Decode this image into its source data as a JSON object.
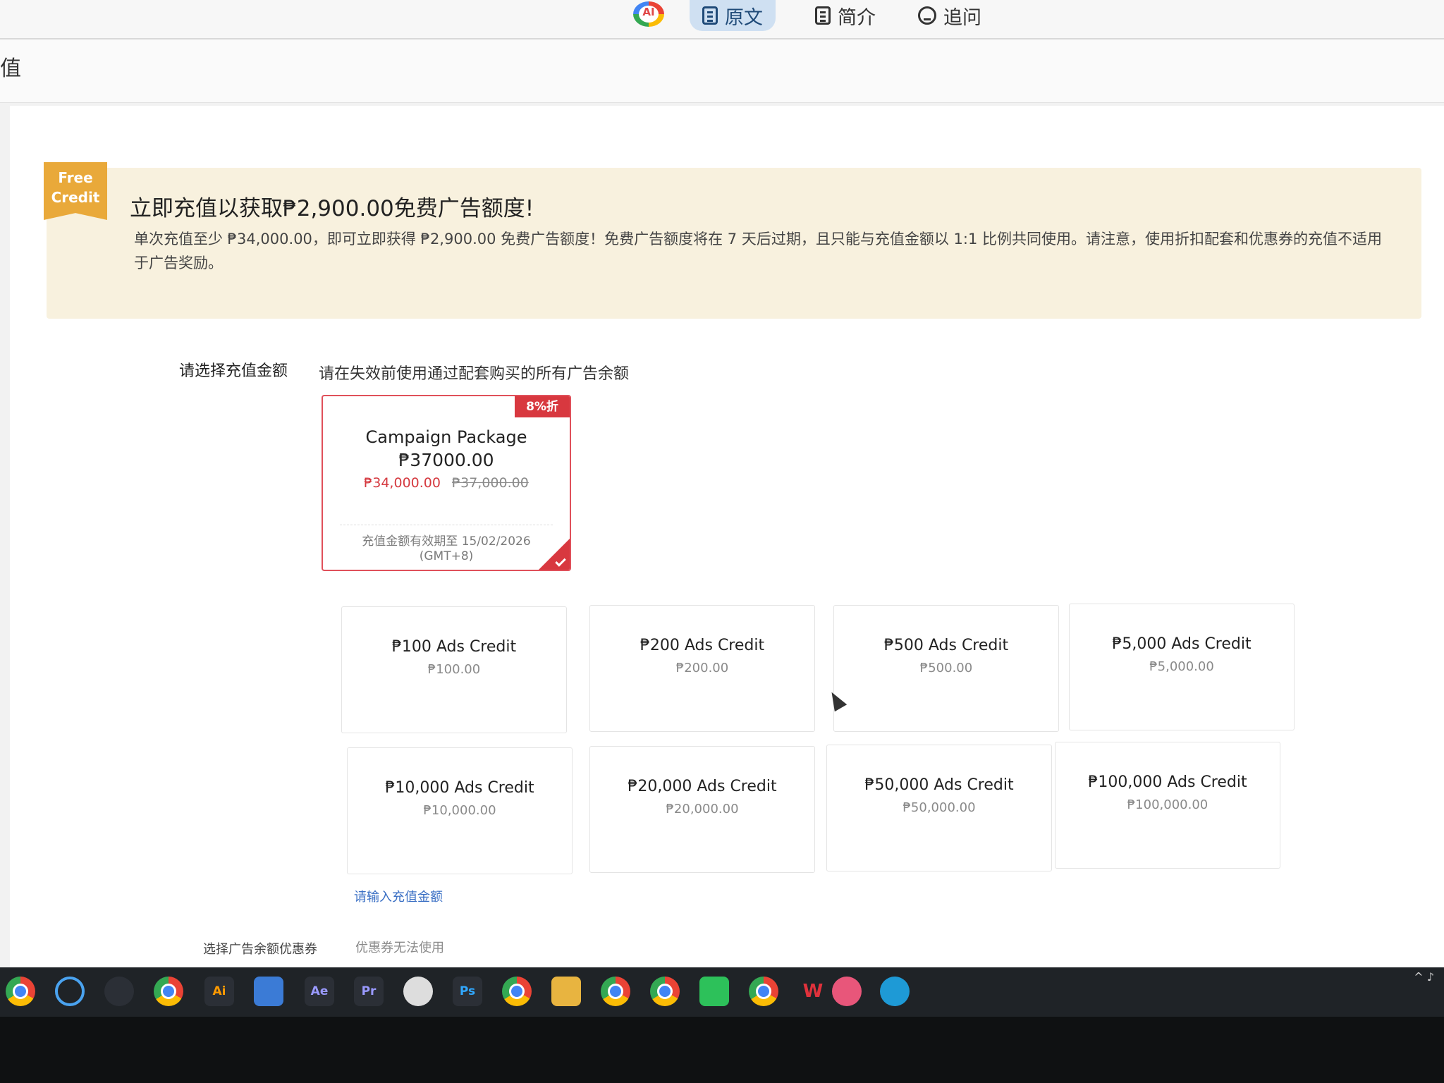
{
  "reader_bar": {
    "ai_logo": "AI",
    "tabs": [
      {
        "label": "原文",
        "icon": "document-icon",
        "active": true
      },
      {
        "label": "简介",
        "icon": "clipboard-icon",
        "active": false
      },
      {
        "label": "追问",
        "icon": "chat-icon",
        "active": false
      }
    ]
  },
  "page_header": {
    "title": "值"
  },
  "banner": {
    "badge_line1": "Free",
    "badge_line2": "Credit",
    "title": "立即充值以获取₱2,900.00免费广告额度!",
    "description": "单次充值至少 ₱34,000.00，即可立即获得 ₱2,900.00 免费广告额度！免费广告额度将在 7 天后过期，且只能与充值金额以 1:1 比例共同使用。请注意，使用折扣配套和优惠券的充值不适用于广告奖励。"
  },
  "selection": {
    "label": "请选择充值金额",
    "note": "请在失效前使用通过配套购买的所有广告余额"
  },
  "campaign": {
    "discount": "8%折",
    "name": "Campaign Package",
    "price": "₱37000.00",
    "sale_price": "₱34,000.00",
    "original_price": "₱37,000.00",
    "expiry": "充值金额有效期至 15/02/2026",
    "timezone": "(GMT+8)",
    "selected": true
  },
  "credits": [
    {
      "name": "₱100 Ads Credit",
      "price": "₱100.00"
    },
    {
      "name": "₱200 Ads Credit",
      "price": "₱200.00"
    },
    {
      "name": "₱500 Ads Credit",
      "price": "₱500.00"
    },
    {
      "name": "₱5,000 Ads Credit",
      "price": "₱5,000.00"
    },
    {
      "name": "₱10,000 Ads Credit",
      "price": "₱10,000.00"
    },
    {
      "name": "₱20,000 Ads Credit",
      "price": "₱20,000.00"
    },
    {
      "name": "₱50,000 Ads Credit",
      "price": "₱50,000.00"
    },
    {
      "name": "₱100,000 Ads Credit",
      "price": "₱100,000.00"
    }
  ],
  "custom_amount_link": "请输入充值金额",
  "coupon": {
    "label": "选择广告余额优惠券",
    "note": "优惠券无法使用"
  },
  "taskbar": {
    "icons": [
      "chrome-icon",
      "search-icon",
      "davinci-icon",
      "chrome-icon",
      "illustrator-icon",
      "app-icon",
      "after-effects-icon",
      "premiere-icon",
      "obs-icon",
      "photoshop-icon",
      "chrome-icon",
      "file-explorer-icon",
      "chrome-icon",
      "chrome-icon",
      "wechat-icon",
      "chrome-icon",
      "wps-icon",
      "ai-assistant-icon",
      "edge-icon"
    ],
    "labels": {
      "ai": "Ai",
      "ae": "Ae",
      "pr": "Pr",
      "ps": "Ps"
    }
  },
  "colors": {
    "accent_red": "#d8383f",
    "banner_bg": "#f8f1de",
    "badge_orange": "#e9a93a",
    "link_blue": "#3a6fc4"
  }
}
